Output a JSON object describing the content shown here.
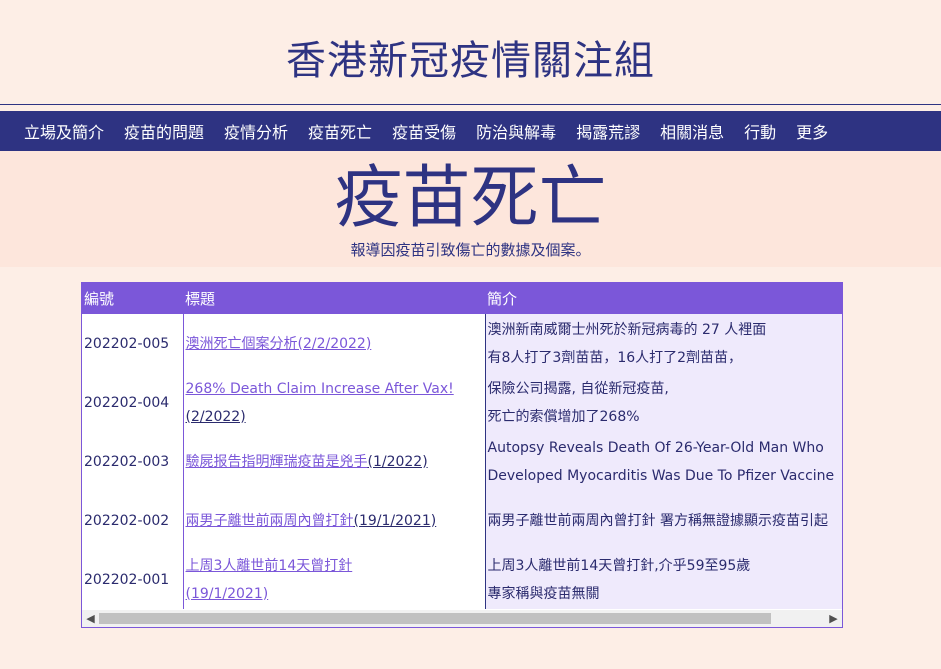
{
  "site": {
    "title": "香港新冠疫情關注組"
  },
  "nav": [
    {
      "label": "立場及簡介"
    },
    {
      "label": "疫苗的問題"
    },
    {
      "label": "疫情分析"
    },
    {
      "label": "疫苗死亡"
    },
    {
      "label": "疫苗受傷"
    },
    {
      "label": "防治與解毒"
    },
    {
      "label": "揭露荒謬"
    },
    {
      "label": "相關消息"
    },
    {
      "label": "行動"
    },
    {
      "label": "更多"
    }
  ],
  "page": {
    "title": "疫苗死亡",
    "subtitle": "報導因疫苗引致傷亡的數據及個案。"
  },
  "table": {
    "headers": [
      "編號",
      "標題",
      "簡介"
    ],
    "rows": [
      {
        "id": "202202-005",
        "title_link": "澳洲死亡個案分析(2/2/2022)",
        "title_rest": "",
        "title_line2": "",
        "summary1": "澳洲新南威爾士州死於新冠病毒的 27 人裡面",
        "summary2": "有8人打了3劑苗苗，16人打了2劑苗苗，"
      },
      {
        "id": "202202-004",
        "title_link": "268% Death Claim Increase After Vax!",
        "title_rest": "",
        "title_line2": "(2/2022)",
        "summary1": "保險公司揭露, 自從新冠疫苗,",
        "summary2": "死亡的索償增加了268%"
      },
      {
        "id": "202202-003",
        "title_link": "驗屍报告指明輝瑞疫苗是兇手",
        "title_rest": "(1/2022)",
        "title_line2": "",
        "summary1": "Autopsy Reveals Death Of 26-Year-Old Man Who",
        "summary2": "Developed Myocarditis Was Due To Pfizer Vaccine"
      },
      {
        "id": "202202-002",
        "title_link": "兩男子離世前兩周內曾打針",
        "title_rest": "(19/1/2021)",
        "title_line2": "",
        "summary1": "兩男子離世前兩周內曾打針 署方稱無證據顯示疫苗引起",
        "summary2": ""
      },
      {
        "id": "202202-001",
        "title_link": "上周3人離世前14天曾打針",
        "title_rest": "",
        "title_line2": "(19/1/2021)",
        "summary1": "上周3人離世前14天曾打針,介乎59至95歲",
        "summary2": "專家稱與疫苗無關"
      }
    ]
  }
}
